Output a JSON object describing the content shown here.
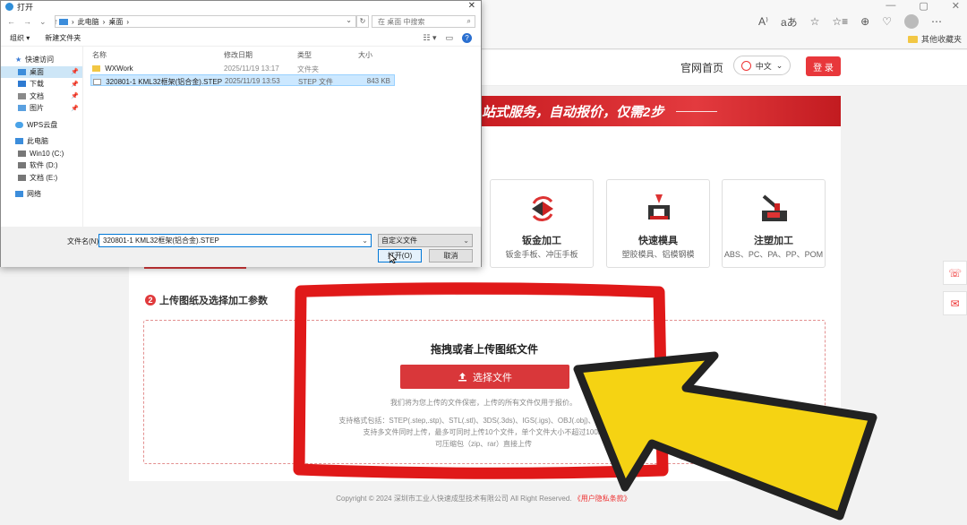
{
  "browser": {
    "window_controls": [
      "—",
      "▢",
      "✕"
    ],
    "addr_icons": [
      "A⁾",
      "aあ",
      "☆",
      "☆≡",
      "⊕",
      "♡"
    ],
    "bookmark_label": "其他收藏夹"
  },
  "site": {
    "nav_home": "官网首页",
    "lang": "中文",
    "login": "登 录",
    "banner": "站式服务，自动报价，仅需2步",
    "services": [
      {
        "title": "钣金加工",
        "desc": "钣金手板、冲压手板"
      },
      {
        "title": "快速模具",
        "desc": "塑胶模具、铝模钢模"
      },
      {
        "title": "注塑加工",
        "desc": "ABS、PC、PA、PP、POM"
      }
    ],
    "step2_num": "2",
    "step2_title": "上传图纸及选择加工参数",
    "upload_heading": "拖拽或者上传图纸文件",
    "choose_file": "选择文件",
    "privacy_note": "我们将为您上传的文件保密，上传的所有文件仅用于报价。",
    "format_lines": [
      "支持格式包括：STEP(.step,.stp)、STL(.stl)、3DS(.3ds)、IGS(.igs)、OBJ(.obj)、ACIS(.x_t)",
      "支持多文件同时上传，最多可同时上传10个文件，单个文件大小不超过100M",
      "可压缩包（zip、rar）直接上传"
    ],
    "footer_text": "Copyright © 2024 深圳市工业人快速成型技术有限公司 All Right Reserved.",
    "footer_link": "《用户隐私条款》"
  },
  "dialog": {
    "title": "打开",
    "close": "✕",
    "path": [
      "此电脑",
      "桌面"
    ],
    "search_placeholder": "在 桌面 中搜索",
    "toolbar": {
      "organize": "组织 ▾",
      "new_folder": "新建文件夹"
    },
    "sidebar": [
      {
        "label": "快速访问",
        "pinned": false,
        "level": 0,
        "selected": false,
        "icon": "star-icon"
      },
      {
        "label": "桌面",
        "pinned": true,
        "level": 1,
        "selected": true,
        "icon": "desktop-icon"
      },
      {
        "label": "下载",
        "pinned": true,
        "level": 1,
        "selected": false,
        "icon": "download-icon"
      },
      {
        "label": "文档",
        "pinned": true,
        "level": 1,
        "selected": false,
        "icon": "document-icon"
      },
      {
        "label": "图片",
        "pinned": true,
        "level": 1,
        "selected": false,
        "icon": "picture-icon"
      },
      {
        "label": "WPS云盘",
        "pinned": false,
        "level": 0,
        "selected": false,
        "icon": "cloud-icon"
      },
      {
        "label": "此电脑",
        "pinned": false,
        "level": 0,
        "selected": false,
        "icon": "computer-icon"
      },
      {
        "label": "Win10 (C:)",
        "pinned": false,
        "level": 1,
        "selected": false,
        "icon": "drive-icon"
      },
      {
        "label": "软件 (D:)",
        "pinned": false,
        "level": 1,
        "selected": false,
        "icon": "drive-icon"
      },
      {
        "label": "文档 (E:)",
        "pinned": false,
        "level": 1,
        "selected": false,
        "icon": "drive-icon"
      },
      {
        "label": "网络",
        "pinned": false,
        "level": 0,
        "selected": false,
        "icon": "network-icon"
      }
    ],
    "columns": [
      "名称",
      "修改日期",
      "类型",
      "大小"
    ],
    "files": [
      {
        "name": "WXWork",
        "date": "2025/11/19 13:17",
        "type": "文件夹",
        "size": "",
        "kind": "folder",
        "selected": false
      },
      {
        "name": "320801-1 KML32框架(铝合金).STEP",
        "date": "2025/11/19 13:53",
        "type": "STEP 文件",
        "size": "843 KB",
        "kind": "file",
        "selected": true
      }
    ],
    "filename_label": "文件名(N):",
    "filename_value": "320801-1 KML32框架(铝合金).STEP",
    "filter": "自定义文件",
    "open_btn": "打开(O)",
    "cancel_btn": "取消"
  },
  "colors": {
    "brand_red": "#e8373b",
    "arrow_yellow": "#f5d313",
    "frame_red": "#e01919"
  }
}
